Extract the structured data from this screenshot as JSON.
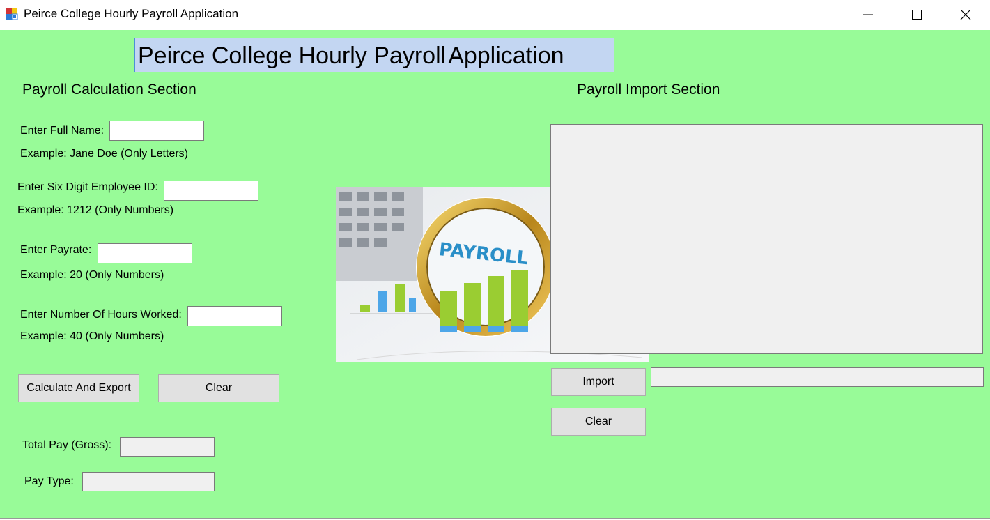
{
  "window": {
    "title": "Peirce College Hourly Payroll Application",
    "controls": [
      "minimize-icon",
      "maximize-icon",
      "close-icon"
    ]
  },
  "header": {
    "title_part1": "Peirce College Hourly Payroll",
    "title_part2": "Application"
  },
  "calculation": {
    "section_title": "Payroll Calculation Section",
    "full_name_label": "Enter Full Name:",
    "full_name_hint": "Example: Jane Doe (Only Letters)",
    "full_name_value": "",
    "employee_id_label": "Enter Six Digit Employee ID:",
    "employee_id_hint": "Example: 1212 (Only Numbers)",
    "employee_id_value": "",
    "payrate_label": "Enter Payrate:",
    "payrate_hint": "Example: 20 (Only Numbers)",
    "payrate_value": "",
    "hours_label": "Enter Number Of Hours Worked:",
    "hours_hint": "Example: 40 (Only Numbers)",
    "hours_value": "",
    "calculate_button": "Calculate And Export",
    "clear_button": "Clear",
    "total_pay_label": "Total Pay (Gross):",
    "total_pay_value": "",
    "pay_type_label": "Pay Type:",
    "pay_type_value": ""
  },
  "image": {
    "text": "PAYROLL",
    "icon": "payroll-magnifier-image"
  },
  "import": {
    "section_title": "Payroll Import Section",
    "import_button": "Import",
    "clear_button": "Clear",
    "file_path_value": ""
  },
  "colors": {
    "background": "#98fb98",
    "title_highlight": "#c3d6f2",
    "button": "#e1e1e1",
    "readonly_field": "#f0f0f0"
  }
}
